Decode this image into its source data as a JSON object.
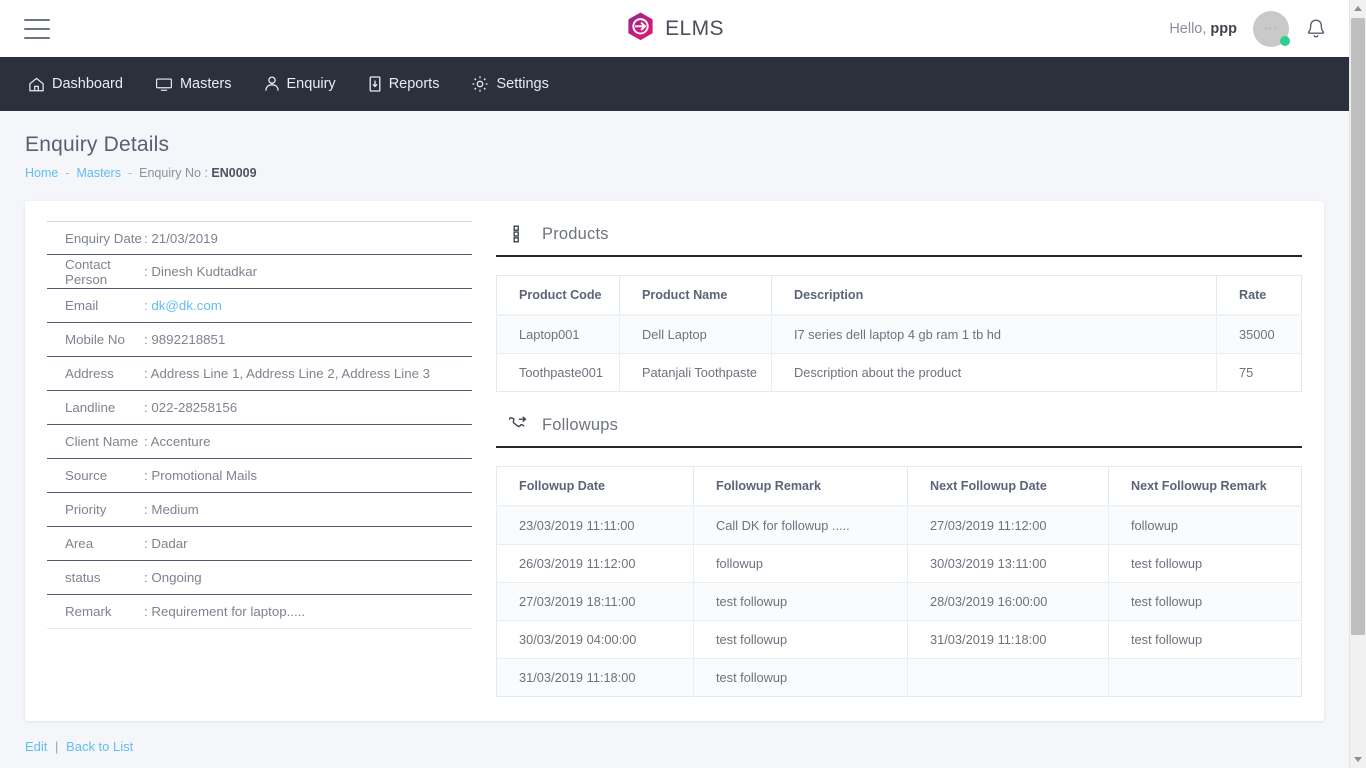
{
  "colors": {
    "brand_pink": "#e0176f",
    "brand_purple": "#8e2b8c",
    "nav_bg": "#2b303c",
    "page_bg": "#f4f6fa",
    "link": "#63bdf0",
    "status_dot": "#2ecf8f"
  },
  "topbar": {
    "menu_icon": "hamburger-icon",
    "brand": "ELMS",
    "brand_logo_icon": "elms-hexagon-logo",
    "greeting_prefix": "Hello,",
    "user_name": "ppp",
    "avatar_icon": "user-avatar",
    "notification_icon": "bell-icon"
  },
  "nav": {
    "items": [
      {
        "label": "Dashboard",
        "icon": "home-icon"
      },
      {
        "label": "Masters",
        "icon": "monitor-icon"
      },
      {
        "label": "Enquiry",
        "icon": "person-icon"
      },
      {
        "label": "Reports",
        "icon": "file-download-icon"
      },
      {
        "label": "Settings",
        "icon": "gear-icon"
      }
    ]
  },
  "page": {
    "title": "Enquiry Details",
    "breadcrumb": {
      "home": "Home",
      "masters": "Masters",
      "separator": "-",
      "current_label": "Enquiry No :",
      "current_value": "EN0009"
    }
  },
  "details": [
    {
      "label": "Enquiry Date",
      "value": ": 21/03/2019",
      "link": false
    },
    {
      "label": "Contact Person",
      "value": ": Dinesh Kudtadkar",
      "link": false
    },
    {
      "label": "Email",
      "value": ": dk@dk.com",
      "link": true
    },
    {
      "label": "Mobile No",
      "value": ": 9892218851",
      "link": false
    },
    {
      "label": "Address",
      "value": ": Address Line 1, Address Line 2, Address Line 3",
      "link": false
    },
    {
      "label": "Landline",
      "value": ": 022-28258156",
      "link": false
    },
    {
      "label": "Client Name",
      "value": ": Accenture",
      "link": false
    },
    {
      "label": "Source",
      "value": ": Promotional Mails",
      "link": false
    },
    {
      "label": "Priority",
      "value": ": Medium",
      "link": false
    },
    {
      "label": "Area",
      "value": ": Dadar",
      "link": false
    },
    {
      "label": "status",
      "value": ": Ongoing",
      "link": false
    },
    {
      "label": "Remark",
      "value": ": Requirement for laptop.....",
      "link": false
    }
  ],
  "products": {
    "section_title": "Products",
    "section_icon": "list-dots-icon",
    "columns": [
      "Product Code",
      "Product Name",
      "Description",
      "Rate"
    ],
    "rows": [
      [
        "Laptop001",
        "Dell Laptop",
        "I7 series dell laptop 4 gb ram 1 tb hd",
        "35000"
      ],
      [
        "Toothpaste001",
        "Patanjali Toothpaste",
        "Description about the product",
        "75"
      ]
    ]
  },
  "followups": {
    "section_title": "Followups",
    "section_icon": "phone-forwarded-icon",
    "columns": [
      "Followup Date",
      "Followup Remark",
      "Next Followup Date",
      "Next Followup Remark"
    ],
    "rows": [
      [
        "23/03/2019 11:11:00",
        "Call DK for followup .....",
        "27/03/2019 11:12:00",
        "followup"
      ],
      [
        "26/03/2019 11:12:00",
        "followup",
        "30/03/2019 13:11:00",
        "test followup"
      ],
      [
        "27/03/2019 18:11:00",
        "test followup",
        "28/03/2019 16:00:00",
        "test followup"
      ],
      [
        "30/03/2019 04:00:00",
        "test followup",
        "31/03/2019 11:18:00",
        "test followup"
      ],
      [
        "31/03/2019 11:18:00",
        "test followup",
        "",
        ""
      ]
    ]
  },
  "footer": {
    "edit": "Edit",
    "separator": "|",
    "back": "Back to List"
  }
}
